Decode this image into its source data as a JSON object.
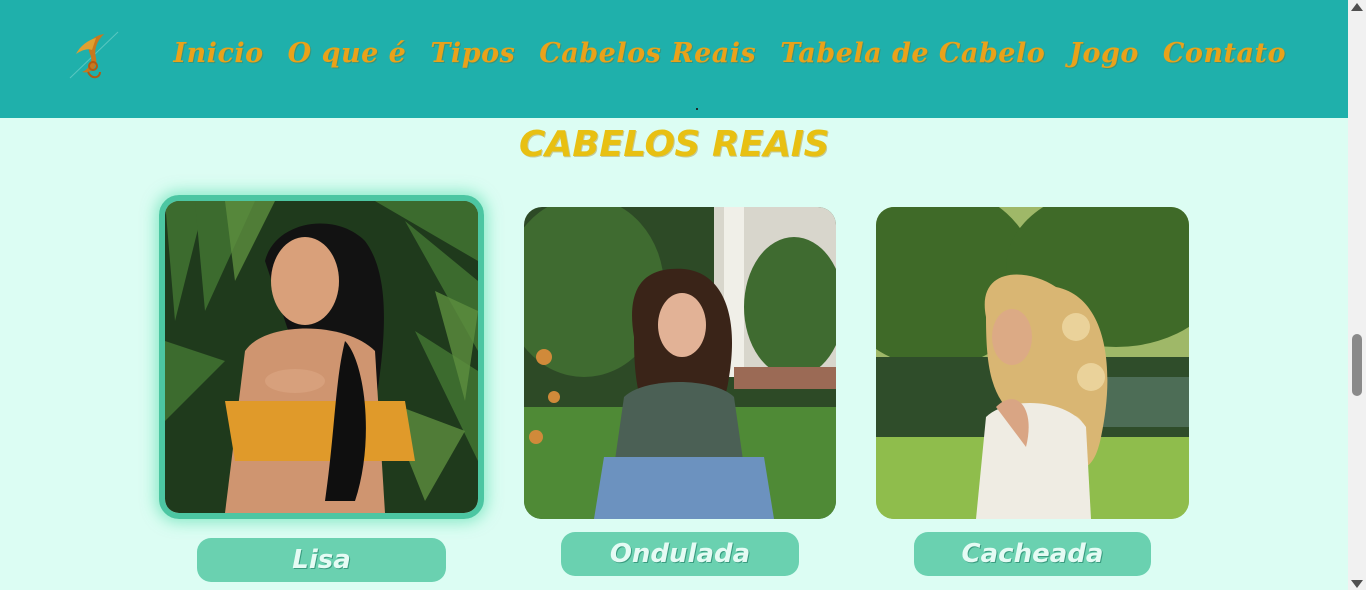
{
  "header": {
    "logo_icon": "hair-woman-logo-icon",
    "nav": [
      {
        "label": "Inicio"
      },
      {
        "label": "O que é"
      },
      {
        "label": "Tipos"
      },
      {
        "label": "Cabelos Reais"
      },
      {
        "label": "Tabela de Cabelo"
      },
      {
        "label": "Jogo"
      },
      {
        "label": "Contato"
      }
    ]
  },
  "main": {
    "title": "CABELOS REAIS",
    "cards": [
      {
        "label": "Lisa",
        "image": "woman-straight-hair-photo"
      },
      {
        "label": "Ondulada",
        "image": "woman-wavy-hair-photo"
      },
      {
        "label": "Cacheada",
        "image": "woman-curly-hair-photo"
      }
    ]
  },
  "colors": {
    "header_bg": "#1fb0ab",
    "page_bg": "#dcfdf3",
    "nav_text": "#e9a21a",
    "title": "#e8c012",
    "button_bg": "#6ad1b0",
    "active_border": "#4cc6a2"
  }
}
